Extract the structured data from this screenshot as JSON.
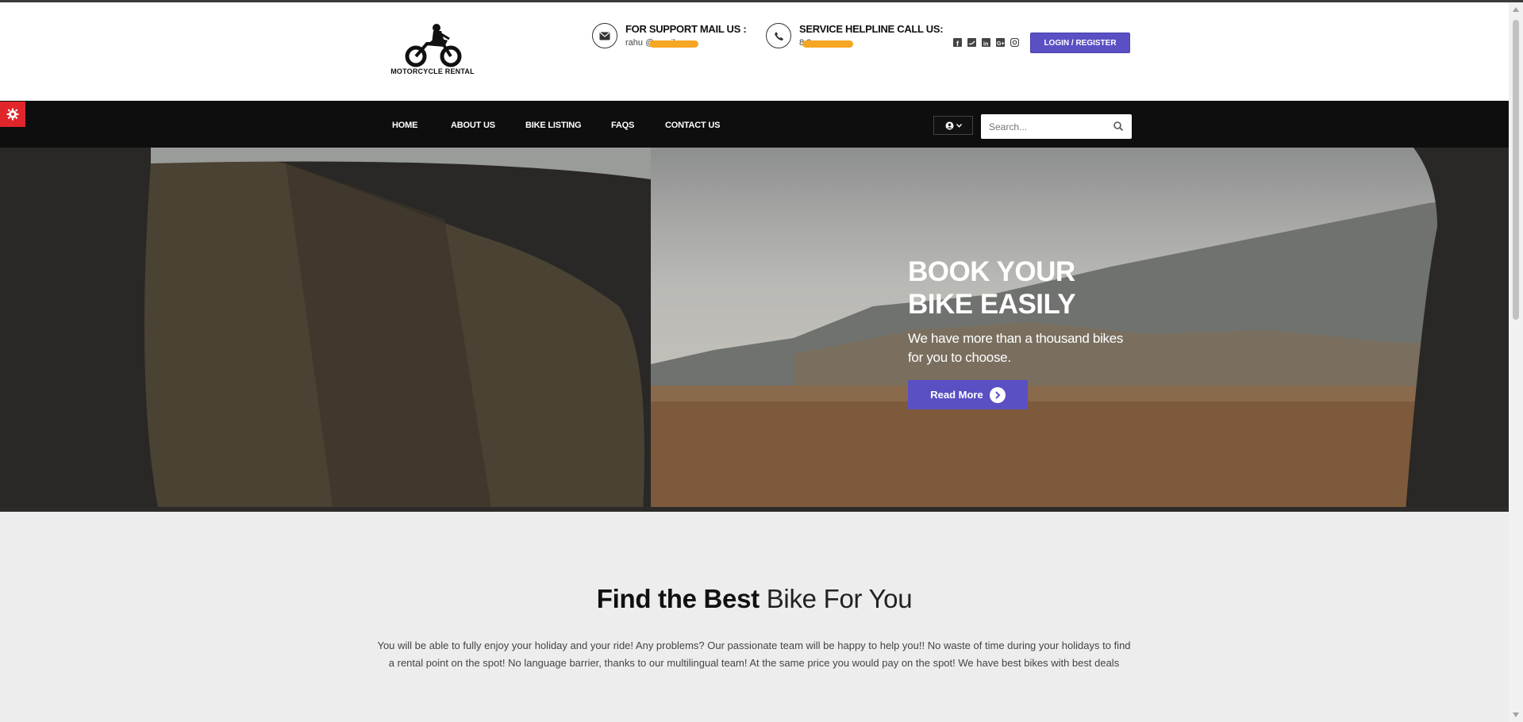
{
  "logo": {
    "text": "MOTORCYCLE RENTAL",
    "icon": "motorcycle-rider-icon"
  },
  "header": {
    "mail": {
      "title": "FOR SUPPORT MAIL US :",
      "value": "rahu                @gmail.com",
      "icon": "envelope-icon"
    },
    "phone": {
      "title": "SERVICE HELPLINE CALL US:",
      "value": "8          2",
      "icon": "phone-icon"
    },
    "social": [
      "facebook-icon",
      "twitter-icon",
      "linkedin-icon",
      "google-plus-icon",
      "instagram-icon"
    ],
    "login_label": "LOGIN / REGISTER"
  },
  "nav": {
    "items": [
      "HOME",
      "ABOUT US",
      "BIKE LISTING",
      "FAQS",
      "CONTACT US"
    ],
    "search_placeholder": "Search...",
    "user_icon": "user-circle-icon"
  },
  "hero": {
    "title_line1": "BOOK YOUR",
    "title_line2": "BIKE EASILY",
    "subtitle_line1": "We have more than a thousand bikes",
    "subtitle_line2": "for you to choose.",
    "button_label": "Read More"
  },
  "section": {
    "title_bold": "Find the Best",
    "title_light": "Bike For You",
    "text": "You will be able to fully enjoy your holiday and your ride! Any problems? Our passionate team will be happy to help you!! No waste of time during your holidays to find a rental point on the spot! No language barrier, thanks to our multilingual team! At the same price you would pay on the spot! We have best bikes with best deals"
  },
  "colors": {
    "accent": "#5b4fc4",
    "nav_bg": "#0e0e0e",
    "settings_red": "#e0262b",
    "redaction": "#f5a623"
  }
}
